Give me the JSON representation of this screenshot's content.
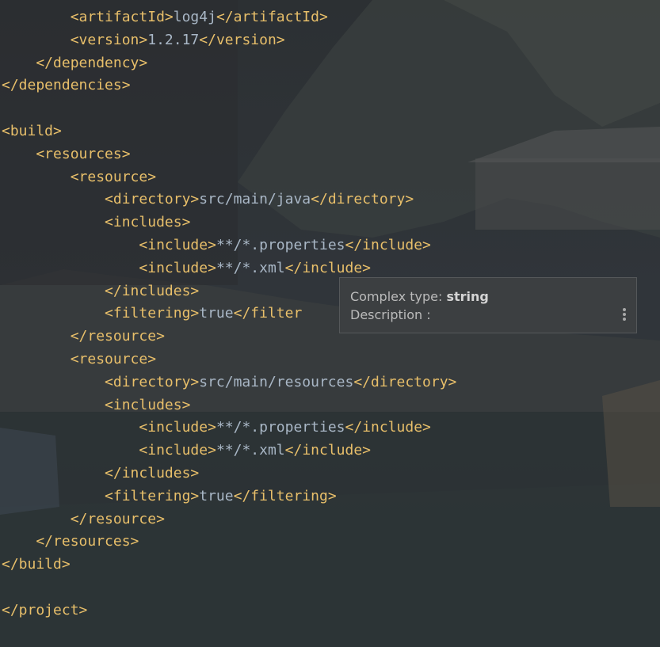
{
  "editor": {
    "lines": [
      [
        [
          "tag",
          "        <artifactId>"
        ],
        [
          "txt",
          "log4j"
        ],
        [
          "tag",
          "</artifactId>"
        ]
      ],
      [
        [
          "tag",
          "        <version>"
        ],
        [
          "txt",
          "1.2.17"
        ],
        [
          "tag",
          "</version>"
        ]
      ],
      [
        [
          "tag",
          "    </dependency>"
        ]
      ],
      [
        [
          "tag",
          "</dependencies>"
        ]
      ],
      [],
      [
        [
          "tag",
          "<build>"
        ]
      ],
      [
        [
          "tag",
          "    <resources>"
        ]
      ],
      [
        [
          "tag",
          "        <resource>"
        ]
      ],
      [
        [
          "tag",
          "            <directory>"
        ],
        [
          "txt",
          "src/main/java"
        ],
        [
          "tag",
          "</directory>"
        ]
      ],
      [
        [
          "tag",
          "            <includes>"
        ]
      ],
      [
        [
          "tag",
          "                <include>"
        ],
        [
          "txt",
          "**/*.properties"
        ],
        [
          "tag",
          "</include>"
        ]
      ],
      [
        [
          "tag",
          "                <include>"
        ],
        [
          "txt",
          "**/*.xml"
        ],
        [
          "tag",
          "</include>"
        ]
      ],
      [
        [
          "tag",
          "            </includes>"
        ]
      ],
      [
        [
          "tag",
          "            <filtering>"
        ],
        [
          "txt",
          "true"
        ],
        [
          "tag",
          "</filter"
        ]
      ],
      [
        [
          "tag",
          "        </resource>"
        ]
      ],
      [
        [
          "tag",
          "        <resource>"
        ]
      ],
      [
        [
          "tag",
          "            <directory>"
        ],
        [
          "txt",
          "src/main/resources"
        ],
        [
          "tag",
          "</directory>"
        ]
      ],
      [
        [
          "tag",
          "            <includes>"
        ]
      ],
      [
        [
          "tag",
          "                <include>"
        ],
        [
          "txt",
          "**/*.properties"
        ],
        [
          "tag",
          "</include>"
        ]
      ],
      [
        [
          "tag",
          "                <include>"
        ],
        [
          "txt",
          "**/*.xml"
        ],
        [
          "tag",
          "</include>"
        ]
      ],
      [
        [
          "tag",
          "            </includes>"
        ]
      ],
      [
        [
          "tag",
          "            <filtering>"
        ],
        [
          "txt",
          "true"
        ],
        [
          "tag",
          "</filtering>"
        ]
      ],
      [
        [
          "tag",
          "        </resource>"
        ]
      ],
      [
        [
          "tag",
          "    </resources>"
        ]
      ],
      [
        [
          "tag",
          "</build>"
        ]
      ],
      [],
      [
        [
          "tag",
          "</project>"
        ]
      ]
    ]
  },
  "tooltip": {
    "type_label": "Complex type: ",
    "type_value": "string",
    "description_label": "Description :",
    "more_icon": "vertical-ellipsis-icon"
  },
  "colors": {
    "tag": "#e8bf6a",
    "text": "#a9b7c6",
    "tooltip_bg": "#3c3f41"
  }
}
